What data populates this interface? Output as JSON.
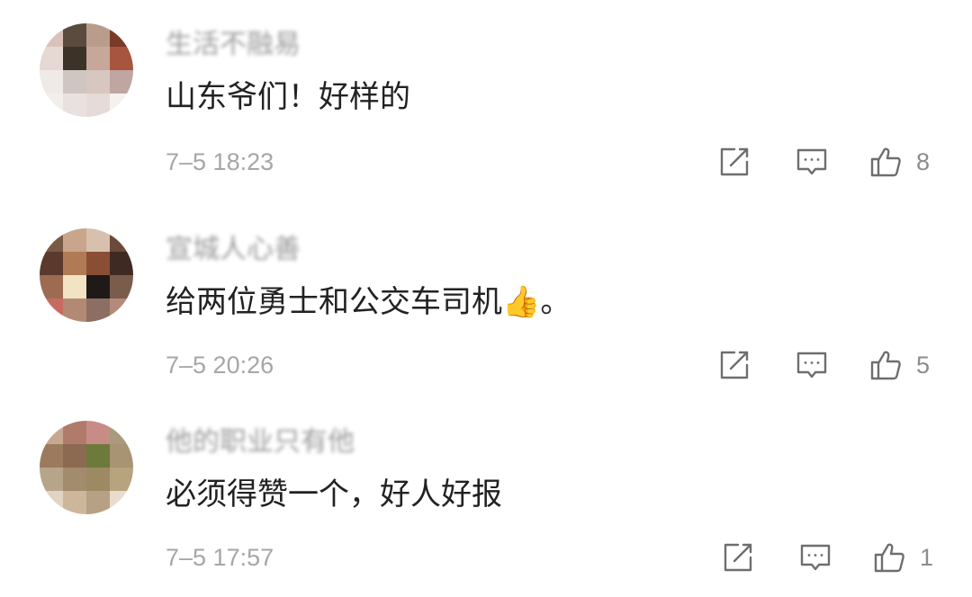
{
  "comments": [
    {
      "username": "生活不融易",
      "text": "山东爷们！好样的",
      "time": "7–5 18:23",
      "likes": "8",
      "avatar_colors": [
        "#d9c3b8",
        "#5b4a3e",
        "#b99d8c",
        "#7a3a2a",
        "#e6d8d2",
        "#3d3228",
        "#c7a79a",
        "#a7553f",
        "#efe9e7",
        "#cfc6c2",
        "#d8c7c0",
        "#bfa6a0",
        "#f2eeec",
        "#e8e1df",
        "#e5dcd9",
        "#f4f1ef"
      ]
    },
    {
      "username": "宣城人心善",
      "text": "给两位勇士和公交车司机",
      "emoji": "👍",
      "text_suffix": "。",
      "time": "7–5 20:26",
      "likes": "5",
      "avatar_colors": [
        "#7a5a45",
        "#c9a58c",
        "#d8c0ae",
        "#6b4a3a",
        "#5a3a2c",
        "#b07a55",
        "#8a4e34",
        "#3e2a22",
        "#9c6b52",
        "#f1e3c4",
        "#1f1a18",
        "#7a5c4d",
        "#c76a60",
        "#b28a74",
        "#8c6f62",
        "#b58a7a"
      ]
    },
    {
      "username": "他的职业只有他",
      "text": "必须得赞一个，好人好报",
      "time": "7–5 17:57",
      "likes": "1",
      "avatar_colors": [
        "#c9a892",
        "#b07b6a",
        "#c88c87",
        "#a99a7e",
        "#9c7a5e",
        "#8c6a52",
        "#6c7a3c",
        "#a89372",
        "#b7a58a",
        "#a38b6e",
        "#9e8a62",
        "#b8a37f",
        "#e2d4c2",
        "#cdb79b",
        "#b6a184",
        "#e9dccd"
      ]
    }
  ],
  "icons": {
    "share": "share-icon",
    "reply": "reply-icon",
    "like": "like-icon"
  },
  "colors": {
    "username": "#9a9a9a",
    "text": "#222222",
    "time": "#a6a6a6",
    "icon": "#6e6e6e"
  }
}
